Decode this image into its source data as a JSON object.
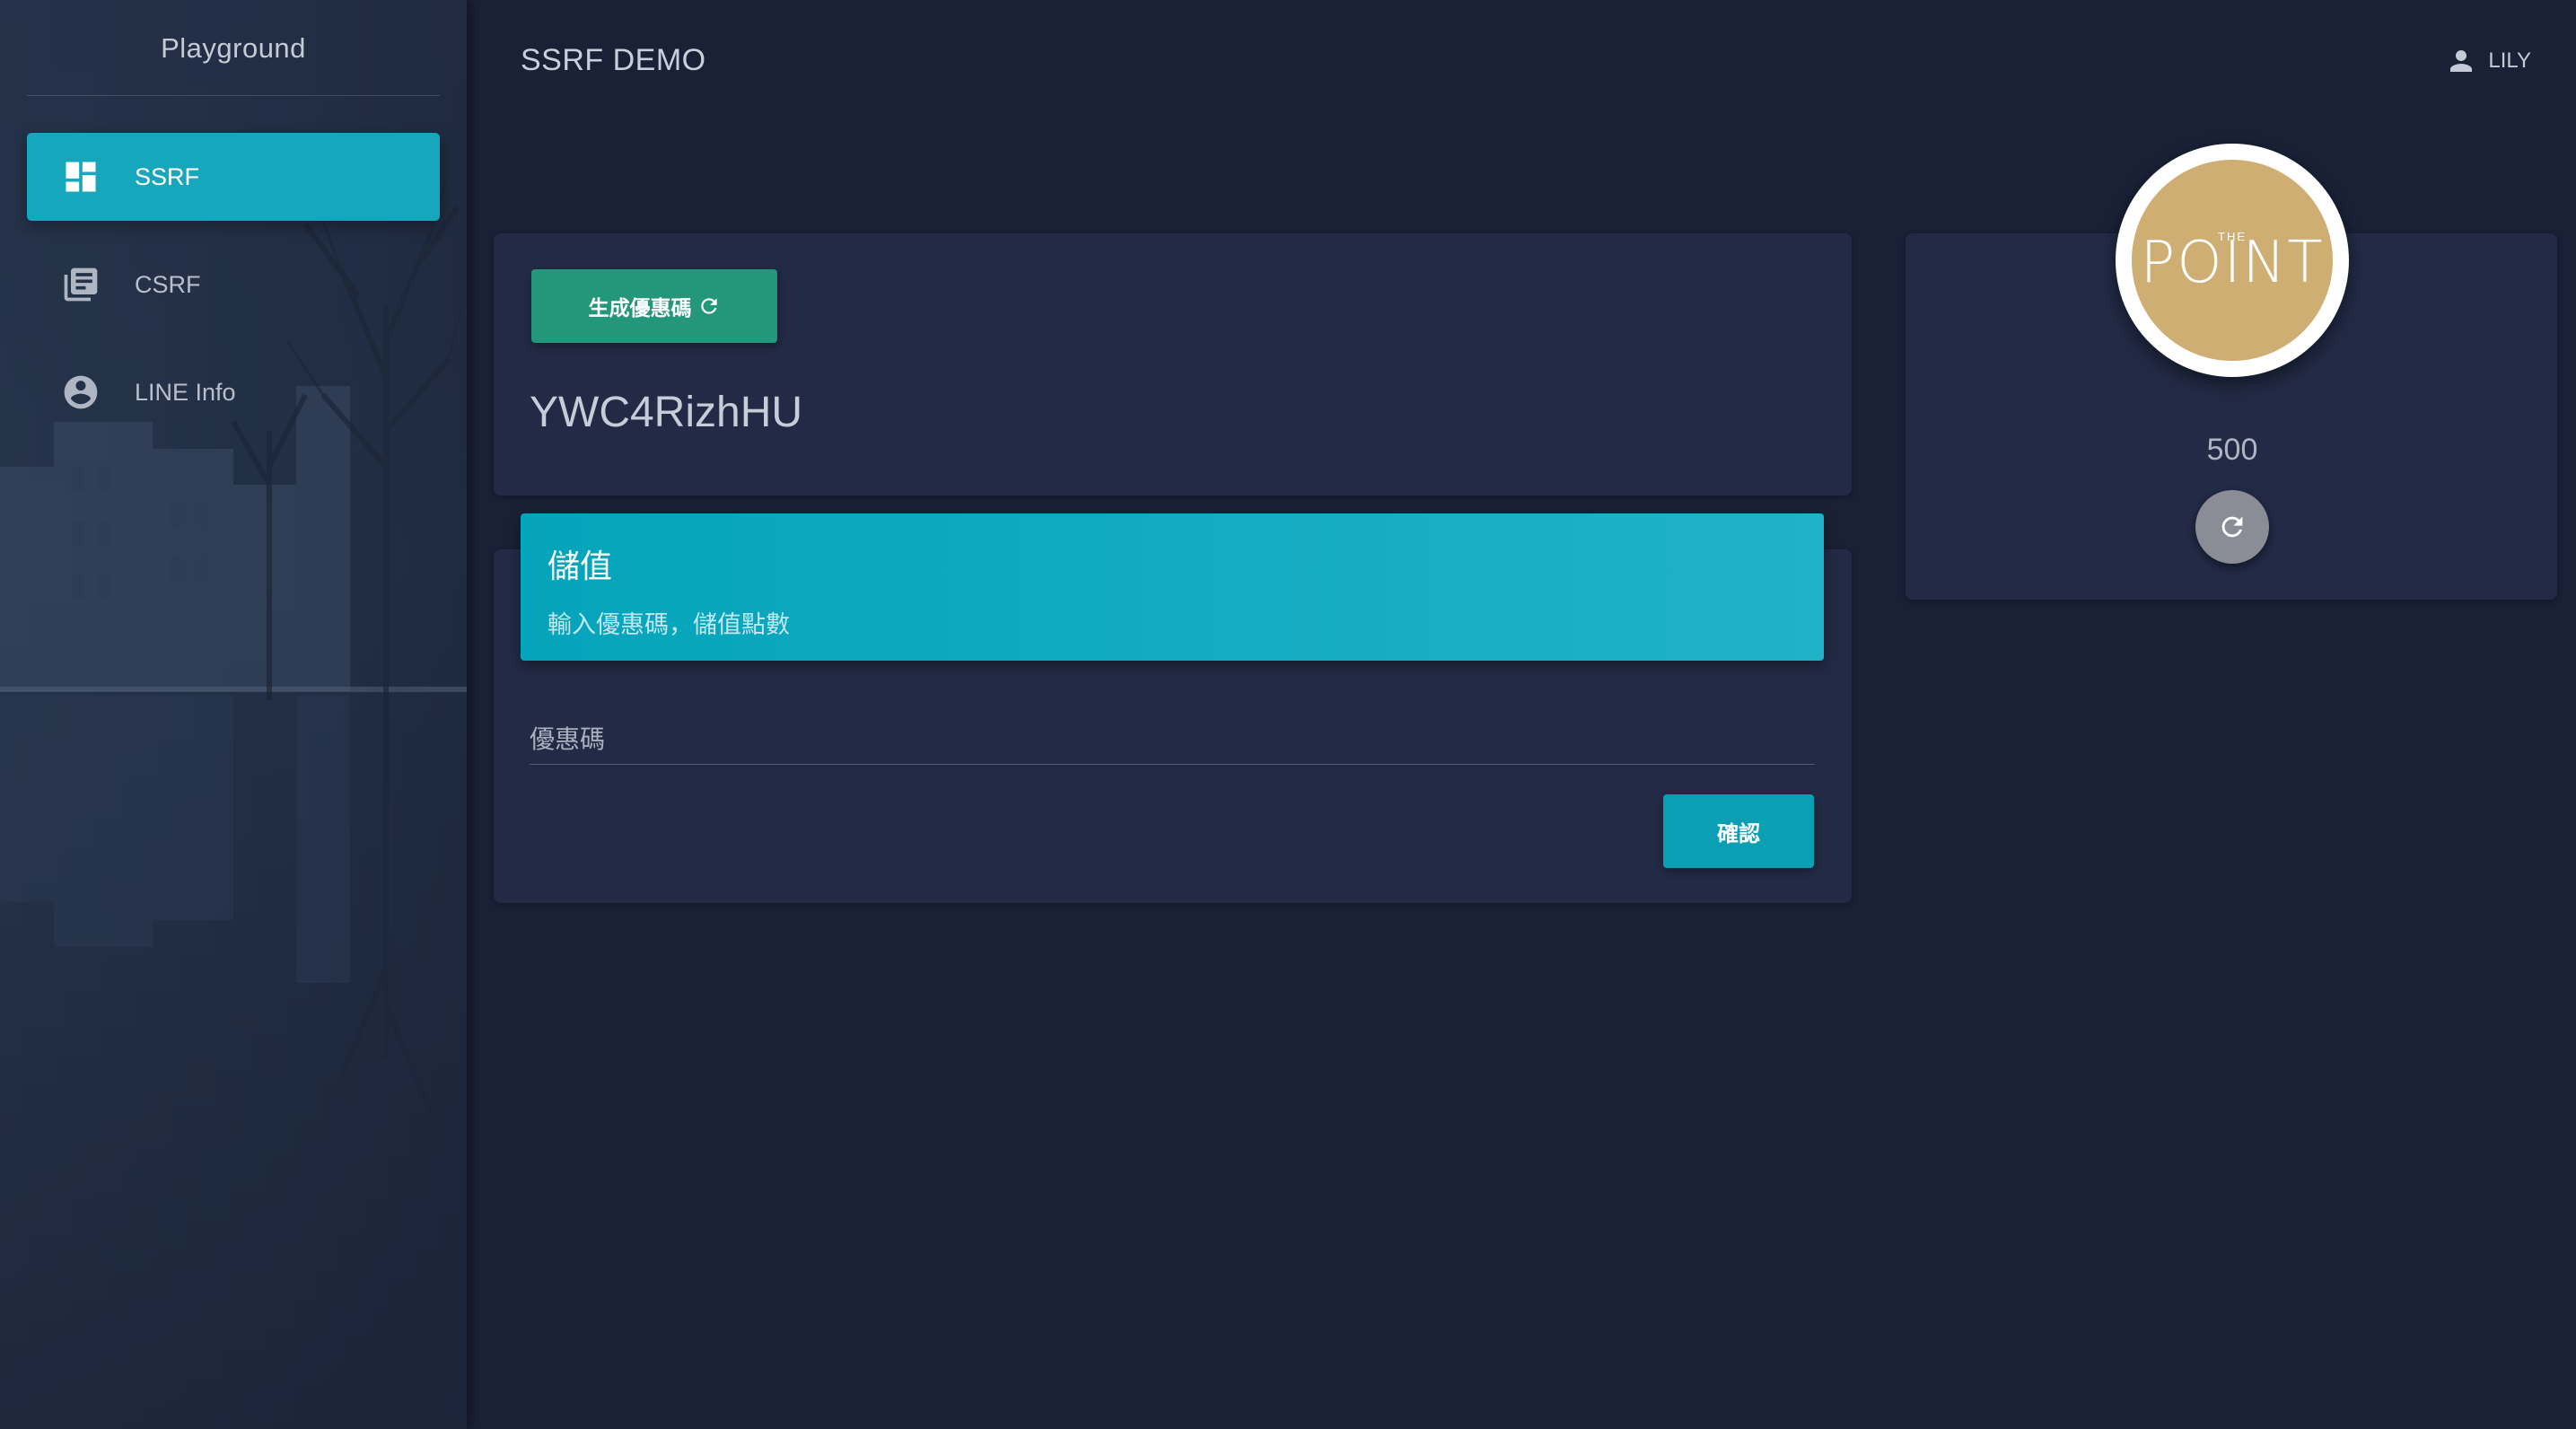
{
  "sidebar": {
    "brand": "Playground",
    "items": [
      {
        "label": "SSRF",
        "icon": "dashboard-icon",
        "active": true
      },
      {
        "label": "CSRF",
        "icon": "library-books-icon",
        "active": false
      },
      {
        "label": "LINE Info",
        "icon": "account-circle-icon",
        "active": false
      }
    ]
  },
  "header": {
    "title": "SSRF DEMO",
    "user": "LILY",
    "user_icon": "person-icon"
  },
  "coupon_card": {
    "generate_label": "生成優惠碼",
    "generate_icon": "refresh-icon",
    "code": "YWC4RizhHU"
  },
  "deposit_card": {
    "title": "儲值",
    "subtitle": "輸入優惠碼，儲值點數",
    "input_placeholder": "優惠碼",
    "input_value": "",
    "confirm_label": "確認"
  },
  "points_card": {
    "logo_small": "THE",
    "logo_text": "POINT",
    "points": "500",
    "refresh_icon": "refresh-icon"
  },
  "colors": {
    "background": "#1a2036",
    "card": "#222a45",
    "accent_cyan": "#17a7bd",
    "accent_green": "#23977a",
    "logo_gold": "#cfae73"
  }
}
